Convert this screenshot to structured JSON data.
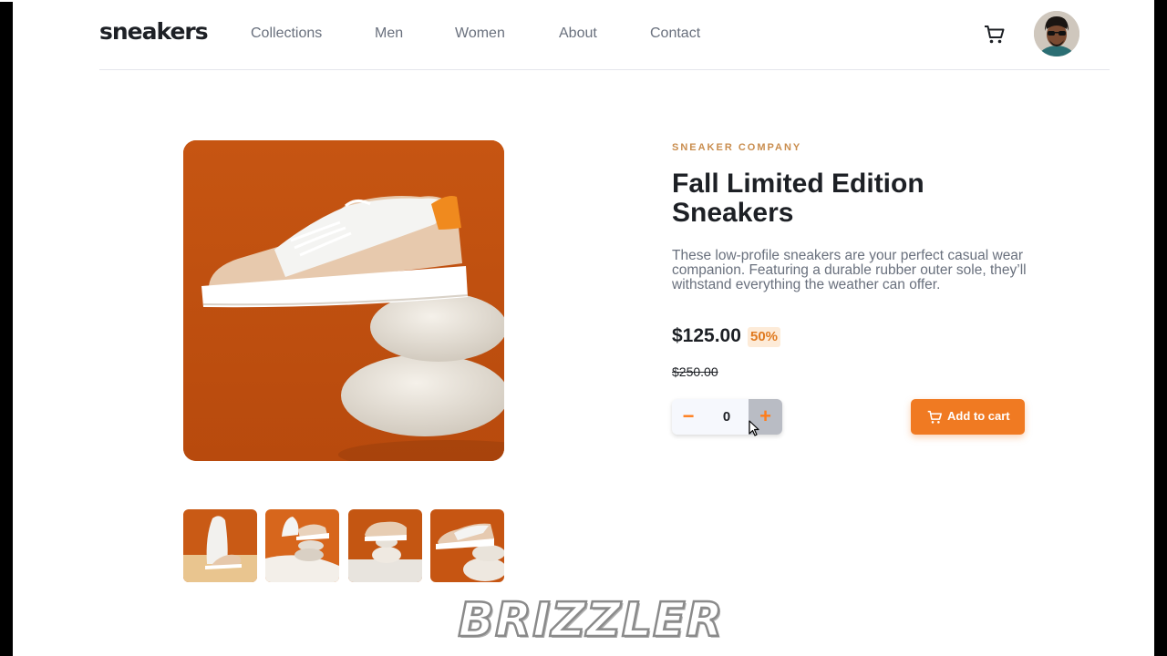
{
  "brand": {
    "logo": "sneakers"
  },
  "nav": {
    "items": [
      "Collections",
      "Men",
      "Women",
      "About",
      "Contact"
    ]
  },
  "header_icons": {
    "cart": "cart-icon",
    "avatar": "user-avatar"
  },
  "product": {
    "company": "SNEAKER COMPANY",
    "title": "Fall Limited Edition Sneakers",
    "description": "These low-profile sneakers are your perfect casual wear companion. Featuring a durable rubber outer sole, they’ll withstand everything the weather can offer.",
    "price": "$125.00",
    "discount": "50%",
    "original_price": "$250.00"
  },
  "cart_controls": {
    "minus": "−",
    "quantity": "0",
    "plus": "+",
    "add_label": "Add to cart"
  },
  "thumbnails": {
    "count": 4
  },
  "watermark": "BRIZZLER",
  "colors": {
    "accent": "#ff7d1a",
    "button": "#f07a22",
    "company": "#c98d4e",
    "text_dark": "#1d2025",
    "text_muted": "#69707d",
    "image_bg": "#c85a14"
  }
}
